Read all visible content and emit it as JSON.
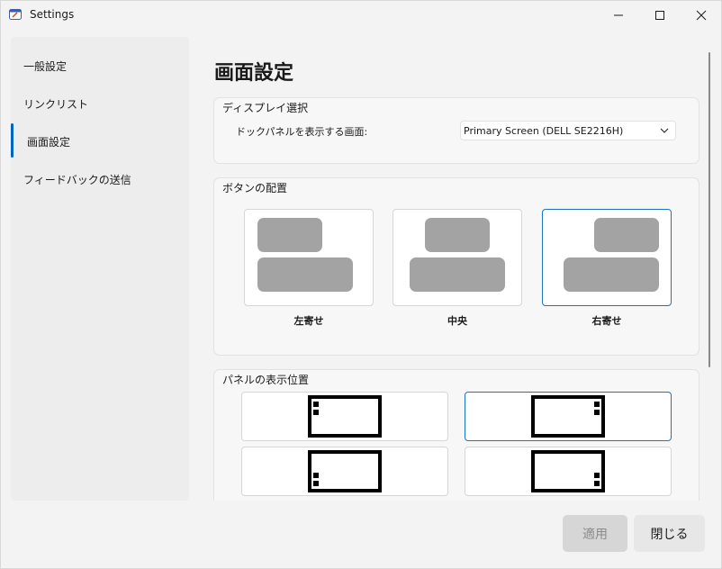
{
  "window": {
    "title": "Settings"
  },
  "sidebar": {
    "items": [
      {
        "label": "一般設定"
      },
      {
        "label": "リンクリスト"
      },
      {
        "label": "画面設定"
      },
      {
        "label": "フィードバックの送信"
      }
    ],
    "active_index": 2
  },
  "main": {
    "title": "画面設定",
    "display_section": {
      "title": "ディスプレイ選択",
      "label": "ドックパネルを表示する画面:",
      "selected_screen": "Primary Screen (DELL SE2216H)"
    },
    "alignment_section": {
      "title": "ボタンの配置",
      "options": [
        {
          "label": "左寄せ"
        },
        {
          "label": "中央"
        },
        {
          "label": "右寄せ"
        }
      ],
      "selected_index": 2
    },
    "position_section": {
      "title": "パネルの表示位置",
      "selected_index": 1
    }
  },
  "footer": {
    "apply_label": "適用",
    "close_label": "閉じる"
  },
  "colors": {
    "accent": "#1d73c4",
    "sidebar_indicator": "#0067c0",
    "block_gray": "#a3a3a3"
  }
}
